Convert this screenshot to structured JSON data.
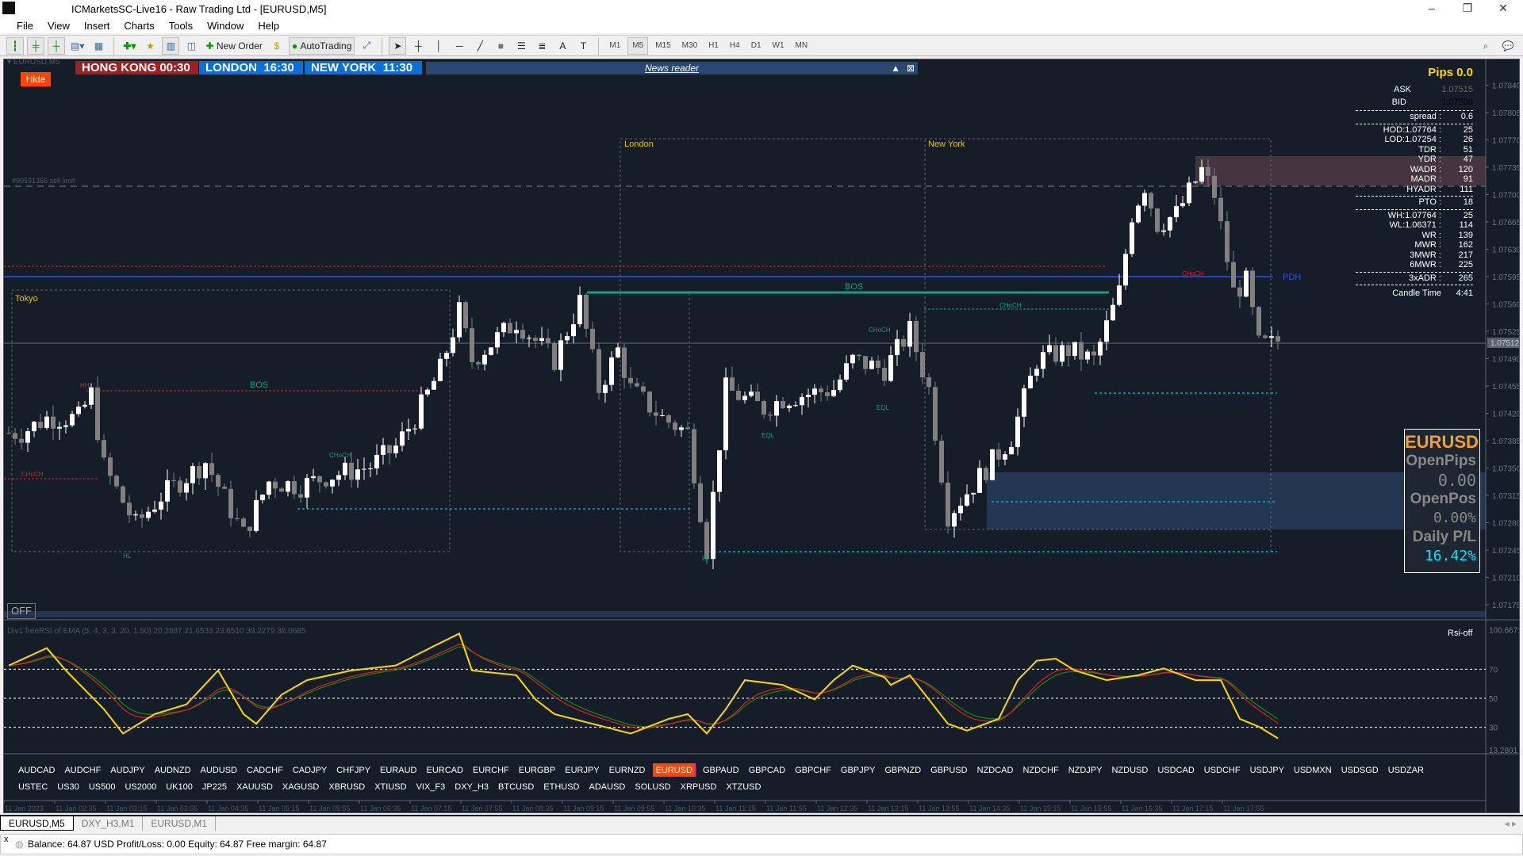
{
  "window": {
    "title": "ICMarketsSC-Live16 - Raw Trading Ltd - [EURUSD,M5]"
  },
  "menu": [
    "File",
    "View",
    "Insert",
    "Charts",
    "Tools",
    "Window",
    "Help"
  ],
  "toolbar": {
    "new_order": "New Order",
    "auto_trading": "AutoTrading",
    "timeframes": [
      "M1",
      "M5",
      "M15",
      "M30",
      "H1",
      "H4",
      "D1",
      "W1",
      "MN"
    ],
    "active_timeframe": "M5"
  },
  "chart": {
    "symbol_label": "EURUSD,M5",
    "hide_label": "Hide",
    "clocks": [
      {
        "label": "HONG KONG 00:30",
        "color": "#9b2222"
      },
      {
        "label": "LONDON  16:30",
        "color": "#0a6fd6"
      },
      {
        "label": "NEW YORK  11:30",
        "color": "#0a6fd6"
      }
    ],
    "news_reader": "News reader",
    "sell_limit": "#90591366 sell limit",
    "sessions": [
      "Tokyo",
      "London",
      "New York"
    ],
    "annotations": [
      "HH",
      "HL",
      "LL",
      "BOS",
      "BOS",
      "CHoCH",
      "CHoCH",
      "CHoCH",
      "CHoCH",
      "EQL",
      "EQL",
      "CHoCH",
      "PDH"
    ],
    "off_label": "OFF",
    "price_ticks": [
      "1.07840",
      "1.07805",
      "1.07770",
      "1.07735",
      "1.07700",
      "1.07665",
      "1.07630",
      "1.07595",
      "1.07560",
      "1.07525",
      "1.07490",
      "1.07455",
      "1.07420",
      "1.07385",
      "1.07350",
      "1.07315",
      "1.07280",
      "1.07245",
      "1.07210",
      "1.07175"
    ],
    "current_price": "1.07512",
    "time_ticks": [
      "11 Jan 2023",
      "11 Jan 02:35",
      "11 Jan 03:15",
      "11 Jan 03:55",
      "11 Jan 04:35",
      "11 Jan 05:15",
      "11 Jan 05:55",
      "11 Jan 06:35",
      "11 Jan 07:15",
      "11 Jan 07:55",
      "11 Jan 08:35",
      "11 Jan 09:15",
      "11 Jan 09:55",
      "11 Jan 10:35",
      "11 Jan 11:15",
      "11 Jan 11:55",
      "11 Jan 12:35",
      "11 Jan 13:15",
      "11 Jan 13:55",
      "11 Jan 14:35",
      "11 Jan 15:15",
      "11 Jan 15:55",
      "11 Jan 16:35",
      "11 Jan 17:15",
      "11 Jan 17:55"
    ]
  },
  "info": {
    "pips": "Pips 0.0",
    "ask_label": "ASK",
    "ask": "1.07515",
    "bid_label": "BID",
    "bid": "1.07509",
    "rows": [
      {
        "l": "spread :",
        "v": "0.6",
        "sep": true
      },
      {
        "l": "HOD:1.07764 :",
        "v": "25"
      },
      {
        "l": "LOD:1.07254 :",
        "v": "26"
      },
      {
        "l": "TDR :",
        "v": "51"
      },
      {
        "l": "YDR :",
        "v": "47"
      },
      {
        "l": "WADR :",
        "v": "120"
      },
      {
        "l": "MADR :",
        "v": "91"
      },
      {
        "l": "HYADR :",
        "v": "111",
        "sep": true
      },
      {
        "l": "PTO :",
        "v": "18",
        "sep": true
      },
      {
        "l": "WH:1.07764 :",
        "v": "25"
      },
      {
        "l": "WL:1.06371 :",
        "v": "114"
      },
      {
        "l": "WR :",
        "v": "139"
      },
      {
        "l": "MWR :",
        "v": "162"
      },
      {
        "l": "3MWR :",
        "v": "217"
      },
      {
        "l": "6MWR :",
        "v": "225",
        "sep": true
      },
      {
        "l": "3xADR :",
        "v": "265",
        "sep": true
      },
      {
        "l": "Candle Time",
        "v": "4:41"
      }
    ]
  },
  "panel": {
    "symbol": "EURUSD",
    "open_pips_label": "OpenPips",
    "open_pips": "0.00",
    "open_pos_label": "OpenPos",
    "open_pos": "0.00%",
    "daily_pl_label": "Daily P/L",
    "daily_pl": "16.42%"
  },
  "rsi": {
    "title": "Div1 freeRSI of EMA (5, 4, 3, 3, 20, 1.50) 20.2887 21.6533 23.6510 39.2279 38.0685",
    "status": "Rsi-off",
    "top": "100.6671",
    "bottom": "13.2801",
    "levels": [
      "70",
      "50",
      "30"
    ]
  },
  "symbols": {
    "row1": [
      "AUDCAD",
      "AUDCHF",
      "AUDJPY",
      "AUDNZD",
      "AUDUSD",
      "CADCHF",
      "CADJPY",
      "CHFJPY",
      "EURAUD",
      "EURCAD",
      "EURCHF",
      "EURGBP",
      "EURJPY",
      "EURNZD",
      "EURUSD",
      "GBPAUD",
      "GBPCAD",
      "GBPCHF",
      "GBPJPY",
      "GBPNZD",
      "GBPUSD",
      "NZDCAD",
      "NZDCHF",
      "NZDJPY",
      "NZDUSD",
      "USDCAD",
      "USDCHF",
      "USDJPY",
      "USDMXN",
      "USDSGD",
      "USDZAR"
    ],
    "row2": [
      "USTEC",
      "US30",
      "US500",
      "US2000",
      "UK100",
      "JP225",
      "XAUUSD",
      "XAGUSD",
      "XBRUSD",
      "XTIUSD",
      "VIX_F3",
      "DXY_H3",
      "BTCUSD",
      "ETHUSD",
      "ADAUSD",
      "SOLUSD",
      "XRPUSD",
      "XTZUSD"
    ],
    "active": "EURUSD"
  },
  "tabs": [
    "EURUSD,M5",
    "DXY_H3,M1",
    "EURUSD,M1"
  ],
  "status": "Balance: 64.87 USD  Profit/Loss: 0.00  Equity: 64.87  Free margin: 64.87",
  "chart_data": {
    "type": "candlestick",
    "timeframe": "M5",
    "close_waypoints": [
      [
        0,
        1.07395
      ],
      [
        2,
        1.07395
      ],
      [
        6,
        1.07414
      ],
      [
        11,
        1.07414
      ],
      [
        13,
        1.07445
      ],
      [
        15,
        1.07352
      ],
      [
        20,
        1.07277
      ],
      [
        24,
        1.07314
      ],
      [
        31,
        1.07358
      ],
      [
        37,
        1.07265
      ],
      [
        41,
        1.07333
      ],
      [
        46,
        1.07327
      ],
      [
        50,
        1.07339
      ],
      [
        57,
        1.07352
      ],
      [
        61,
        1.07377
      ],
      [
        64,
        1.07414
      ],
      [
        68,
        1.07476
      ],
      [
        71,
        1.0755
      ],
      [
        73,
        1.07488
      ],
      [
        80,
        1.07538
      ],
      [
        86,
        1.07488
      ],
      [
        90,
        1.07563
      ],
      [
        93,
        1.07451
      ],
      [
        96,
        1.07501
      ],
      [
        98,
        1.07451
      ],
      [
        103,
        1.07414
      ],
      [
        107,
        1.07395
      ],
      [
        110,
        1.07246
      ],
      [
        113,
        1.07451
      ],
      [
        119,
        1.07426
      ],
      [
        122,
        1.07439
      ],
      [
        130,
        1.07451
      ],
      [
        133,
        1.07488
      ],
      [
        138,
        1.07476
      ],
      [
        142,
        1.07526
      ],
      [
        145,
        1.07451
      ],
      [
        148,
        1.0729
      ],
      [
        153,
        1.07339
      ],
      [
        158,
        1.07389
      ],
      [
        162,
        1.07488
      ],
      [
        167,
        1.07501
      ],
      [
        171,
        1.07488
      ],
      [
        175,
        1.07575
      ],
      [
        177,
        1.07675
      ],
      [
        179,
        1.07712
      ],
      [
        181,
        1.07662
      ],
      [
        184,
        1.07675
      ],
      [
        188,
        1.07731
      ],
      [
        190,
        1.077
      ],
      [
        193,
        1.07575
      ],
      [
        195,
        1.07588
      ],
      [
        197,
        1.07507
      ],
      [
        200,
        1.07509
      ]
    ],
    "rsi_waypoints": [
      [
        0,
        72.6
      ],
      [
        6,
        84.6
      ],
      [
        9,
        69.2
      ],
      [
        15,
        42.5
      ],
      [
        18,
        25.7
      ],
      [
        23,
        39.1
      ],
      [
        28,
        45.8
      ],
      [
        33,
        69.2
      ],
      [
        37,
        39.1
      ],
      [
        39,
        32.4
      ],
      [
        43,
        52.5
      ],
      [
        47,
        62.5
      ],
      [
        54,
        69.2
      ],
      [
        61,
        72.6
      ],
      [
        67,
        86
      ],
      [
        71,
        94.6
      ],
      [
        73,
        69.2
      ],
      [
        80,
        65.9
      ],
      [
        83,
        49.2
      ],
      [
        86,
        39.1
      ],
      [
        92,
        32.4
      ],
      [
        98,
        25.7
      ],
      [
        104,
        35.8
      ],
      [
        107,
        39.1
      ],
      [
        110,
        25.7
      ],
      [
        113,
        42.5
      ],
      [
        116,
        62.5
      ],
      [
        122,
        59.2
      ],
      [
        127,
        49.2
      ],
      [
        130,
        62.5
      ],
      [
        133,
        72.6
      ],
      [
        138,
        64.5
      ],
      [
        139,
        59.2
      ],
      [
        142,
        65.9
      ],
      [
        145,
        49.2
      ],
      [
        148,
        32.4
      ],
      [
        151,
        27.7
      ],
      [
        156,
        35.8
      ],
      [
        159,
        62.5
      ],
      [
        162,
        75.9
      ],
      [
        165,
        77.3
      ],
      [
        168,
        69.2
      ],
      [
        173,
        62.5
      ],
      [
        178,
        65.9
      ],
      [
        182,
        70.6
      ],
      [
        187,
        62.5
      ],
      [
        191,
        62.5
      ],
      [
        194,
        35.8
      ],
      [
        197,
        30.4
      ],
      [
        200,
        22.4
      ]
    ],
    "price_range": [
      1.0714,
      1.0786
    ],
    "rsi_range": [
      13.2801,
      100.6671
    ]
  }
}
